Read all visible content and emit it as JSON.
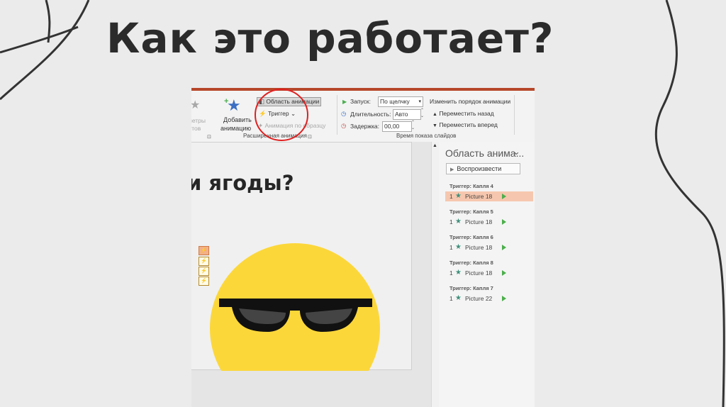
{
  "title": "Как это работает?",
  "ribbon": {
    "effect_params_partial": "метры",
    "effect_params_partial2": "стов",
    "add_animation_line1": "Добавить",
    "add_animation_line2": "анимацию",
    "animation_pane_btn": "Область анимации",
    "trigger_btn": "Триггер",
    "animation_painter": "Анимация по образцу",
    "advanced_group": "Расширенная анимация",
    "start_label": "Запуск:",
    "start_value": "По щелчку",
    "duration_label": "Длительность:",
    "duration_value": "Авто",
    "delay_label": "Задержка:",
    "delay_value": "00,00",
    "timing_group": "Время показа слайдов",
    "reorder_title": "Изменить порядок анимации",
    "move_back": "Переместить назад",
    "move_forward": "Переместить вперед"
  },
  "slide": {
    "text": "и ягоды?"
  },
  "pane": {
    "title": "Область анима...",
    "play_button": "Воспроизвести",
    "groups": [
      {
        "trigger": "Триггер: Капля 4",
        "num": "1",
        "picture": "Picture 18",
        "highlighted": true
      },
      {
        "trigger": "Триггер: Капля 5",
        "num": "1",
        "picture": "Picture 18",
        "highlighted": false
      },
      {
        "trigger": "Триггер: Капля 6",
        "num": "1",
        "picture": "Picture 18",
        "highlighted": false
      },
      {
        "trigger": "Триггер: Капля 8",
        "num": "1",
        "picture": "Picture 18",
        "highlighted": false
      },
      {
        "trigger": "Триггер: Капля 7",
        "num": "1",
        "picture": "Picture 22",
        "highlighted": false
      }
    ]
  },
  "colors": {
    "accent": "#b7472a",
    "highlight_row": "#f6c7ae",
    "smiley": "#fcd73a",
    "circle": "#e02020"
  }
}
